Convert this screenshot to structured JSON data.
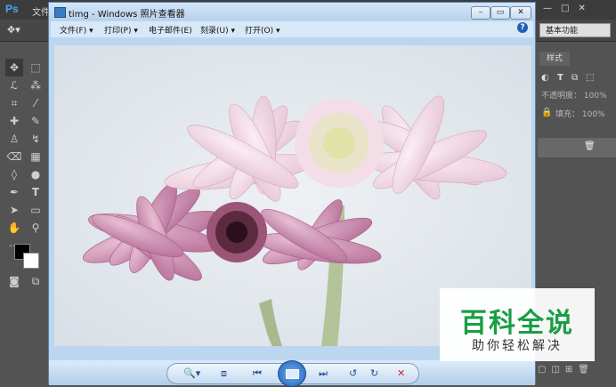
{
  "photoshop": {
    "logo": "Ps",
    "menu_file": "文件",
    "workspace": "基本功能",
    "panel_tab": "样式",
    "opacity_label": "不透明度：",
    "opacity_value": "100%",
    "fill_label": "填充：",
    "fill_value": "100%"
  },
  "viewer": {
    "title": "timg - Windows 照片查看器",
    "menu": [
      {
        "label": "文件(F)"
      },
      {
        "label": "打印(P)"
      },
      {
        "label": "电子邮件(E)"
      },
      {
        "label": "刻录(U)"
      },
      {
        "label": "打开(O)"
      }
    ],
    "help": "?"
  },
  "watermark": {
    "title": "百科全说",
    "subtitle": "助你轻松解决"
  },
  "colors": {
    "accent": "#1f5fb8",
    "watermark_green": "#1a9e44",
    "ps_background": "#535353"
  }
}
